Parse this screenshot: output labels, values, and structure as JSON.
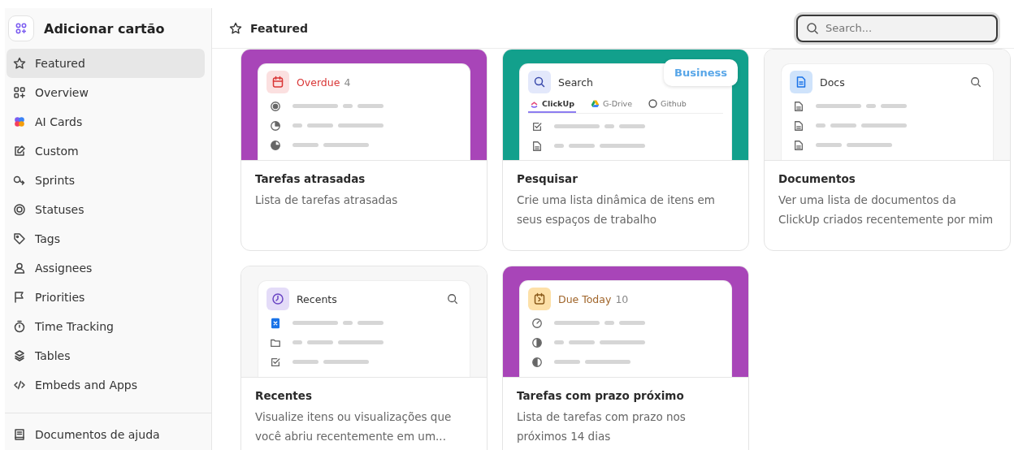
{
  "sidebar": {
    "title": "Adicionar cartão",
    "items": [
      {
        "label": "Featured",
        "selected": true
      },
      {
        "label": "Overview",
        "selected": false
      },
      {
        "label": "AI Cards",
        "selected": false
      },
      {
        "label": "Custom",
        "selected": false
      },
      {
        "label": "Sprints",
        "selected": false
      },
      {
        "label": "Statuses",
        "selected": false
      },
      {
        "label": "Tags",
        "selected": false
      },
      {
        "label": "Assignees",
        "selected": false
      },
      {
        "label": "Priorities",
        "selected": false
      },
      {
        "label": "Time Tracking",
        "selected": false
      },
      {
        "label": "Tables",
        "selected": false
      },
      {
        "label": "Embeds and Apps",
        "selected": false
      }
    ],
    "footer": "Documentos de ajuda"
  },
  "header": {
    "title": "Featured",
    "search": {
      "placeholder": "Search..."
    }
  },
  "cards": [
    {
      "kind": "overdue",
      "color": "#a845b8",
      "preview_title": "Overdue",
      "count": "4",
      "title": "Tarefas atrasadas",
      "description": "Lista de tarefas atrasadas"
    },
    {
      "kind": "search",
      "color": "#12a08c",
      "preview_title": "Search",
      "badge": "Business",
      "tabs": [
        {
          "label": "ClickUp",
          "selected": true
        },
        {
          "label": "G-Drive",
          "selected": false
        },
        {
          "label": "Github",
          "selected": false
        }
      ],
      "title": "Pesquisar",
      "description": "Crie uma lista dinâmica de itens em seus espaços de trabalho"
    },
    {
      "kind": "docs",
      "color": "#f7f7f7",
      "preview_title": "Docs",
      "title": "Documentos",
      "description": "Ver uma lista de documentos da ClickUp criados recentemente por mim"
    },
    {
      "kind": "recents",
      "color": "#f7f7f7",
      "preview_title": "Recents",
      "title": "Recentes",
      "description": "Visualize itens ou visualizações que você abriu recentemente em um..."
    },
    {
      "kind": "due_today",
      "color": "#a845b8",
      "preview_title": "Due Today",
      "count": "10",
      "title": "Tarefas com prazo próximo",
      "description": "Lista de tarefas com prazo nos próximos 14 dias"
    }
  ]
}
